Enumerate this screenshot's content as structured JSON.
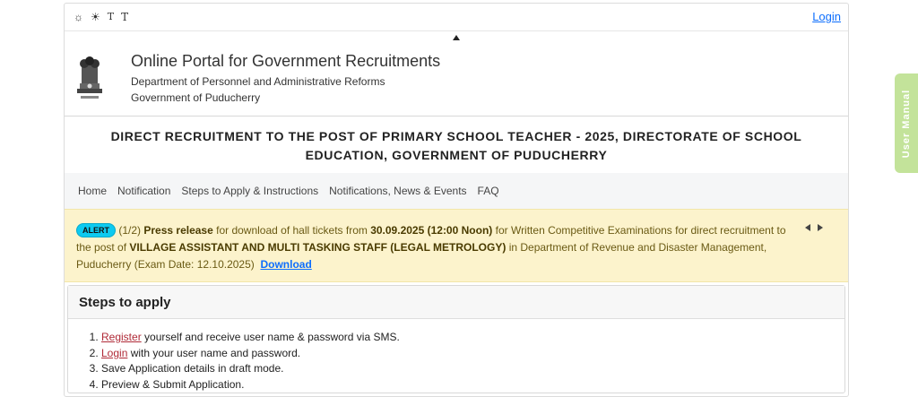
{
  "accessibility": {
    "contrast_light_icon": "sun-outline-icon",
    "contrast_dark_icon": "sun-solid-icon",
    "text_small": "T",
    "text_large": "T"
  },
  "auth": {
    "login_label": "Login"
  },
  "header": {
    "portal_title": "Online Portal for Government Recruitments",
    "department": "Department of Personnel and Administrative Reforms",
    "government": "Government of Puducherry"
  },
  "post_title": "DIRECT RECRUITMENT TO THE POST OF PRIMARY SCHOOL TEACHER - 2025, DIRECTORATE OF SCHOOL EDUCATION, GOVERNMENT OF PUDUCHERRY",
  "nav": {
    "items": [
      {
        "label": "Home"
      },
      {
        "label": "Notification"
      },
      {
        "label": "Steps to Apply & Instructions"
      },
      {
        "label": "Notifications, News & Events"
      },
      {
        "label": "FAQ"
      }
    ]
  },
  "alert": {
    "badge": "ALERT",
    "counter": "(1/2)",
    "press_release": "Press release",
    "text_1": " for download of hall tickets from ",
    "date_time": "30.09.2025 (12:00 Noon)",
    "text_2": " for Written Competitive Examinations for direct recruitment to the post of ",
    "post": "VILLAGE ASSISTANT AND MULTI TASKING STAFF (LEGAL METROLOGY)",
    "text_3": "  in Department of Revenue and Disaster Management, Puducherry (Exam Date: 12.10.2025)",
    "download_label": "Download"
  },
  "steps": {
    "title": "Steps to apply",
    "items": [
      {
        "link": "Register",
        "rest": " yourself and receive user name & password via SMS."
      },
      {
        "link": "Login",
        "rest": " with your user name and password."
      },
      {
        "text": "Save Application details in draft mode."
      },
      {
        "text": "Preview & Submit Application."
      }
    ]
  },
  "side_tab": {
    "label": "User Manual"
  },
  "colors": {
    "accent_link": "#0d6efd",
    "alert_bg": "#fcf3cc",
    "badge_bg": "#0dcaf0",
    "step_link": "#b02a37",
    "user_manual_bg": "#c3e39a"
  }
}
